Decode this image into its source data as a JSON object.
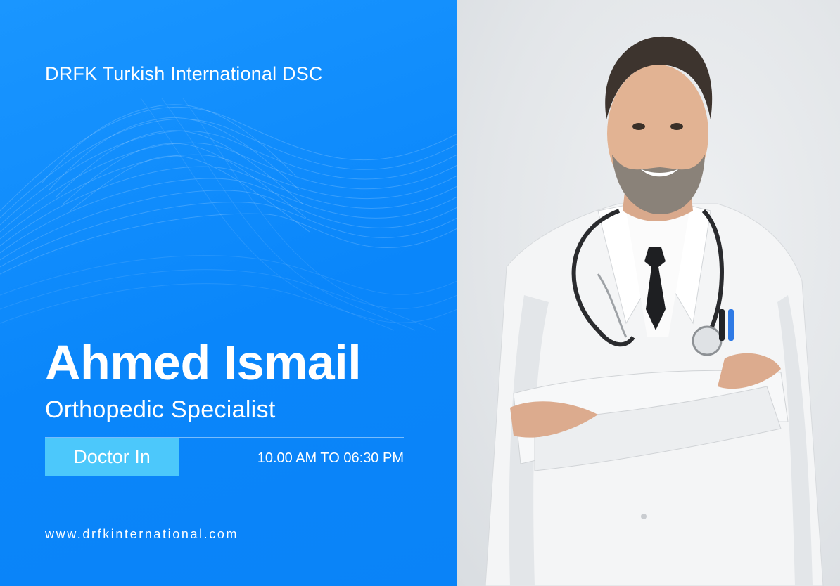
{
  "clinic": {
    "name": "DRFK Turkish International DSC"
  },
  "doctor": {
    "name": "Ahmed Ismail",
    "specialty": "Orthopedic Specialist"
  },
  "availability": {
    "badge_label": "Doctor In",
    "hours": "10.00 AM TO 06:30 PM"
  },
  "footer": {
    "website": "www.drfkinternational.com"
  },
  "colors": {
    "primary_blue": "#0a86fa",
    "badge_cyan": "#4cc8fb",
    "text": "#ffffff",
    "photo_background": "#e3e6e9"
  },
  "images": {
    "doctor_photo": "doctor-portrait"
  }
}
